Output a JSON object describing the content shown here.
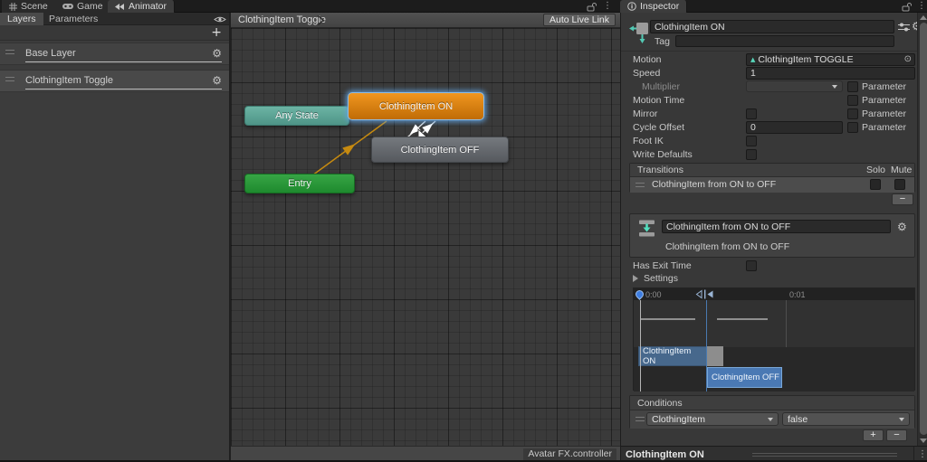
{
  "icons": {
    "gear": "⚙",
    "kebab": "⋮",
    "plus": "+",
    "minus": "−",
    "clip_triangle": "▲",
    "object_picker": "⊙"
  },
  "colors": {
    "node_selected_orange": "#d87c10",
    "node_any_state_teal": "#5ba294",
    "node_entry_green": "#2b9a3a",
    "node_off_gray": "#64686d",
    "selection_glow_blue": "#5fa0dc",
    "timeline_block_blue": "#4a79b4"
  },
  "top_tabs": {
    "scene": "Scene",
    "game": "Game",
    "animator": "Animator",
    "inspector": "Inspector"
  },
  "left_panel": {
    "layers_tab": "Layers",
    "parameters_tab": "Parameters",
    "layers": [
      {
        "name": "Base Layer"
      },
      {
        "name": "ClothingItem Toggle"
      }
    ]
  },
  "graph": {
    "breadcrumb": "ClothingItem Toggle",
    "auto_live_link": "Auto Live Link",
    "status": "Avatar FX.controller",
    "nodes": {
      "any_state": "Any State",
      "on": "ClothingItem ON",
      "off": "ClothingItem OFF",
      "entry": "Entry"
    }
  },
  "inspector": {
    "title": "ClothingItem ON",
    "tag_label": "Tag",
    "tag_value": "",
    "motion": {
      "label": "Motion",
      "value": "ClothingItem TOGGLE"
    },
    "speed": {
      "label": "Speed",
      "value": "1"
    },
    "multiplier": {
      "label": "Multiplier"
    },
    "motion_time": {
      "label": "Motion Time"
    },
    "mirror": {
      "label": "Mirror"
    },
    "cycle_offset": {
      "label": "Cycle Offset",
      "value": "0"
    },
    "foot_ik": {
      "label": "Foot IK"
    },
    "write_defaults": {
      "label": "Write Defaults"
    },
    "parameter_label": "Parameter",
    "transitions": {
      "header": "Transitions",
      "solo": "Solo",
      "mute": "Mute",
      "items": [
        {
          "name": "ClothingItem from ON to OFF"
        }
      ]
    },
    "transition_detail": {
      "name": "ClothingItem from ON to OFF",
      "subtitle": "ClothingItem from ON to OFF",
      "has_exit_time": "Has Exit Time",
      "settings": "Settings",
      "timeline": {
        "start": "0:00",
        "end": "0:01",
        "block_on": "ClothingItem ON",
        "block_off": "ClothingItem OFF"
      },
      "conditions": {
        "header": "Conditions",
        "rows": [
          {
            "parameter": "ClothingItem",
            "value": "false"
          }
        ]
      }
    },
    "footer": "ClothingItem ON"
  }
}
